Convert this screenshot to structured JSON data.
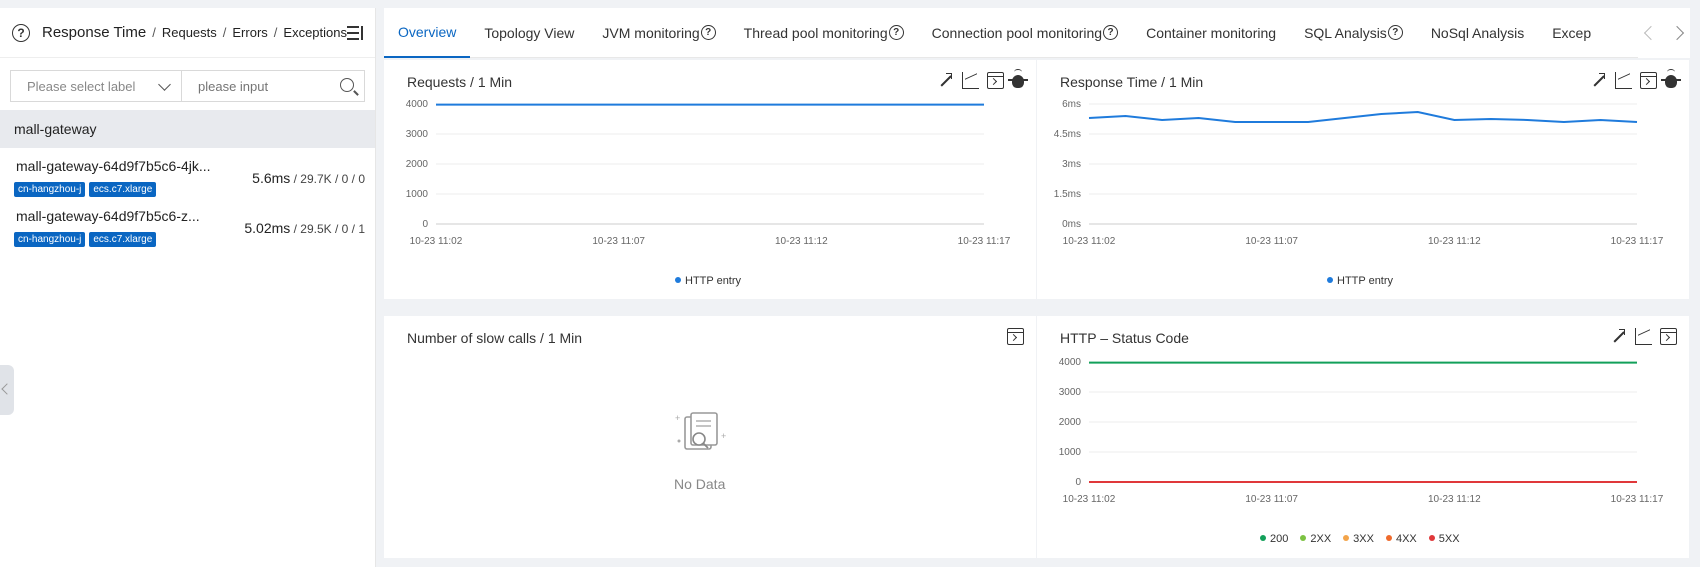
{
  "left": {
    "header": {
      "title": "Response Time",
      "links": [
        "Requests",
        "Errors",
        "Exceptions"
      ]
    },
    "filter": {
      "label_placeholder": "Please select label",
      "input_placeholder": "please input"
    },
    "group": "mall-gateway",
    "instances": [
      {
        "name": "mall-gateway-64d9f7b5c6-4jk...",
        "rt": "5.6ms",
        "rest": " / 29.7K / 0 / 0",
        "tags": [
          "cn-hangzhou-j",
          "ecs.c7.xlarge"
        ]
      },
      {
        "name": "mall-gateway-64d9f7b5c6-z...",
        "rt": "5.02ms",
        "rest": " / 29.5K / 0 / 1",
        "tags": [
          "cn-hangzhou-j",
          "ecs.c7.xlarge"
        ]
      }
    ]
  },
  "tabs": [
    {
      "label": "Overview",
      "help": false
    },
    {
      "label": "Topology View",
      "help": false
    },
    {
      "label": "JVM monitoring",
      "help": true
    },
    {
      "label": "Thread pool monitoring",
      "help": true
    },
    {
      "label": "Connection pool monitoring",
      "help": true
    },
    {
      "label": "Container monitoring",
      "help": false
    },
    {
      "label": "SQL Analysis",
      "help": true
    },
    {
      "label": "NoSql Analysis",
      "help": false
    },
    {
      "label": "Excep",
      "help": false
    }
  ],
  "colors": {
    "accent": "#0a66c2",
    "line_blue": "#1f7bdc",
    "green": "#13a05a",
    "red": "#e0383a"
  },
  "panels": {
    "requests": {
      "title": "Requests / 1 Min"
    },
    "response": {
      "title": "Response Time / 1 Min"
    },
    "slow": {
      "title": "Number of slow calls / 1 Min",
      "empty": "No Data"
    },
    "status": {
      "title": "HTTP – Status Code"
    }
  },
  "chart_data": [
    {
      "type": "line",
      "title": "Requests / 1 Min",
      "x": [
        "10-23 11:02",
        "10-23 11:03",
        "10-23 11:04",
        "10-23 11:05",
        "10-23 11:06",
        "10-23 11:07",
        "10-23 11:08",
        "10-23 11:09",
        "10-23 11:10",
        "10-23 11:11",
        "10-23 11:12",
        "10-23 11:13",
        "10-23 11:14",
        "10-23 11:15",
        "10-23 11:16",
        "10-23 11:17"
      ],
      "xticks": [
        "10-23 11:02",
        "10-23 11:07",
        "10-23 11:12",
        "10-23 11:17"
      ],
      "yticks": [
        "0",
        "1000",
        "2000",
        "3000",
        "4000"
      ],
      "ylim": [
        0,
        4000
      ],
      "series": [
        {
          "name": "HTTP entry",
          "color": "#1f7bdc",
          "values": [
            3980,
            3980,
            3980,
            3980,
            3980,
            3980,
            3980,
            3980,
            3980,
            3980,
            3980,
            3980,
            3980,
            3980,
            3980,
            3980
          ]
        }
      ]
    },
    {
      "type": "line",
      "title": "Response Time / 1 Min",
      "x": [
        "10-23 11:02",
        "10-23 11:03",
        "10-23 11:04",
        "10-23 11:05",
        "10-23 11:06",
        "10-23 11:07",
        "10-23 11:08",
        "10-23 11:09",
        "10-23 11:10",
        "10-23 11:11",
        "10-23 11:12",
        "10-23 11:13",
        "10-23 11:14",
        "10-23 11:15",
        "10-23 11:16",
        "10-23 11:17"
      ],
      "xticks": [
        "10-23 11:02",
        "10-23 11:07",
        "10-23 11:12",
        "10-23 11:17"
      ],
      "yticks": [
        "0ms",
        "1.5ms",
        "3ms",
        "4.5ms",
        "6ms"
      ],
      "ylim": [
        0,
        6
      ],
      "series": [
        {
          "name": "HTTP entry",
          "color": "#1f7bdc",
          "values": [
            5.3,
            5.4,
            5.2,
            5.3,
            5.1,
            5.1,
            5.1,
            5.3,
            5.5,
            5.6,
            5.2,
            5.25,
            5.2,
            5.1,
            5.2,
            5.1
          ]
        }
      ]
    },
    {
      "type": "line",
      "title": "HTTP – Status Code",
      "x": [
        "10-23 11:02",
        "10-23 11:03",
        "10-23 11:04",
        "10-23 11:05",
        "10-23 11:06",
        "10-23 11:07",
        "10-23 11:08",
        "10-23 11:09",
        "10-23 11:10",
        "10-23 11:11",
        "10-23 11:12",
        "10-23 11:13",
        "10-23 11:14",
        "10-23 11:15",
        "10-23 11:16",
        "10-23 11:17"
      ],
      "xticks": [
        "10-23 11:02",
        "10-23 11:07",
        "10-23 11:12",
        "10-23 11:17"
      ],
      "yticks": [
        "0",
        "1000",
        "2000",
        "3000",
        "4000"
      ],
      "ylim": [
        0,
        4000
      ],
      "series": [
        {
          "name": "200",
          "color": "#13a05a",
          "values": [
            3980,
            3980,
            3980,
            3980,
            3980,
            3980,
            3980,
            3980,
            3980,
            3980,
            3980,
            3980,
            3980,
            3980,
            3980,
            3980
          ]
        },
        {
          "name": "2XX",
          "color": "#7cc242",
          "values": [
            0,
            0,
            0,
            0,
            0,
            0,
            0,
            0,
            0,
            0,
            0,
            0,
            0,
            0,
            0,
            0
          ]
        },
        {
          "name": "3XX",
          "color": "#f3a44a",
          "values": [
            0,
            0,
            0,
            0,
            0,
            0,
            0,
            0,
            0,
            0,
            0,
            0,
            0,
            0,
            0,
            0
          ]
        },
        {
          "name": "4XX",
          "color": "#ef6a2c",
          "values": [
            0,
            0,
            0,
            0,
            0,
            0,
            0,
            0,
            0,
            0,
            0,
            0,
            0,
            0,
            0,
            0
          ]
        },
        {
          "name": "5XX",
          "color": "#e0383a",
          "values": [
            0,
            0,
            0,
            0,
            0,
            0,
            0,
            0,
            0,
            0,
            0,
            0,
            0,
            0,
            0,
            0
          ]
        }
      ]
    }
  ]
}
